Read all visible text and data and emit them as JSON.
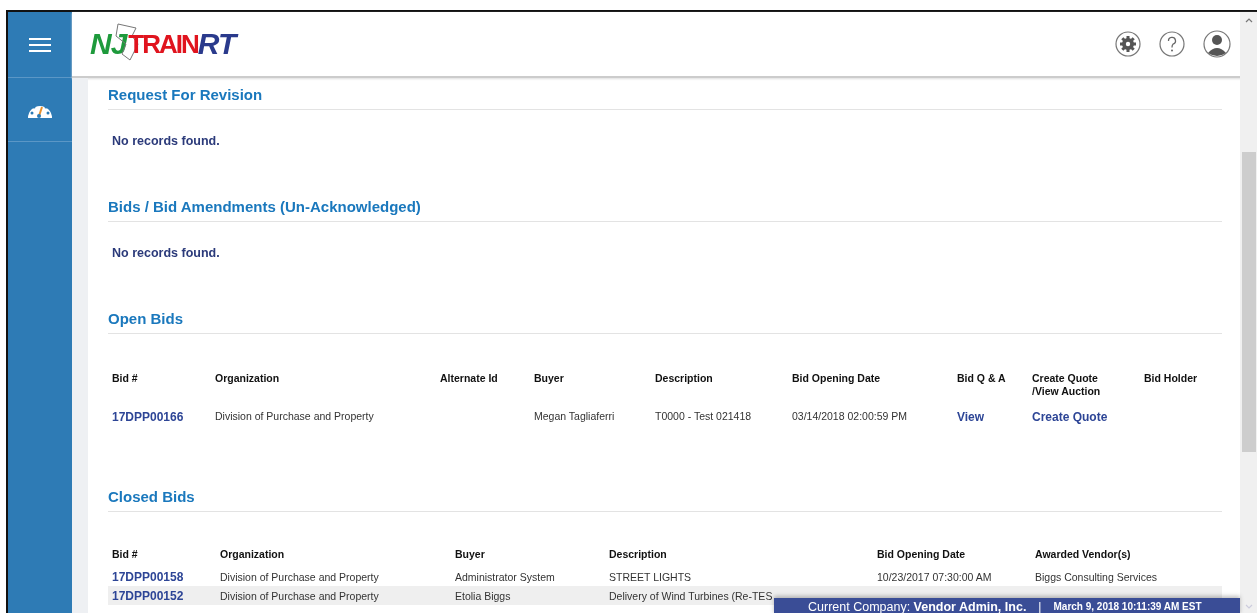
{
  "logo": {
    "left": "NJ",
    "overlay": "TRAIN",
    "right": "RT"
  },
  "sections": [
    {
      "title": "Request For Revision",
      "empty_text": "No records found."
    },
    {
      "title": "Bids / Bid Amendments (Un-Acknowledged)",
      "empty_text": "No records found."
    }
  ],
  "open_bids": {
    "title": "Open Bids",
    "columns": [
      "Bid #",
      "Organization",
      "Alternate Id",
      "Buyer",
      "Description",
      "Bid Opening Date",
      "Bid Q & A",
      "Create Quote /View Auction",
      "Bid Holder"
    ],
    "rows": [
      {
        "bid": "17DPP00166",
        "organization": "Division of Purchase and Property",
        "buyer": "Megan Tagliaferri",
        "description": "T0000 - Test 021418",
        "opening_date": "03/14/2018 02:00:59 PM",
        "qa_link": "View",
        "quote_link": "Create Quote"
      }
    ]
  },
  "closed_bids": {
    "title": "Closed Bids",
    "columns": [
      "Bid #",
      "Organization",
      "Buyer",
      "Description",
      "Bid Opening Date",
      "Awarded Vendor(s)"
    ],
    "rows": [
      {
        "bid": "17DPP00158",
        "organization": "Division of Purchase and Property",
        "buyer": "Administrator System",
        "description": "STREET LIGHTS",
        "opening_date": "10/23/2017 07:30:00 AM",
        "vendor": "Biggs Consulting Services"
      },
      {
        "bid": "17DPP00152",
        "organization": "Division of Purchase and Property",
        "buyer": "Etolia Biggs",
        "description": "Delivery of Wind Turbines (Re-TES"
      }
    ]
  },
  "status_bar": {
    "company_label": "Current Company:",
    "company": "Vendor Admin, Inc.",
    "separator": "|",
    "datetime": "March 9, 2018 10:11:39 AM EST"
  }
}
